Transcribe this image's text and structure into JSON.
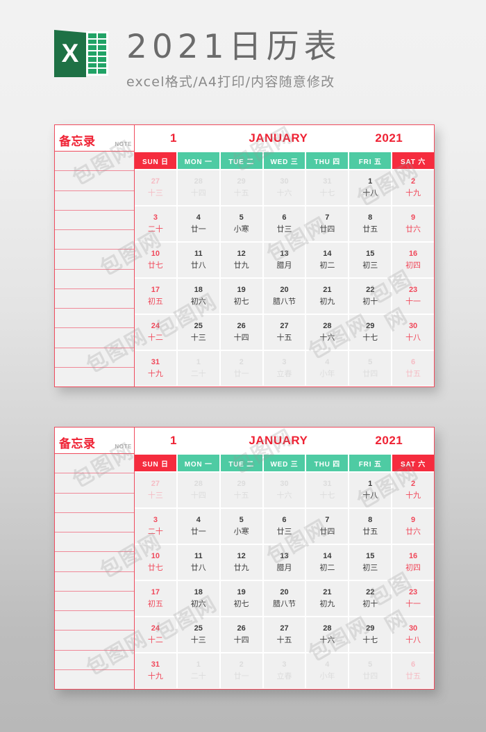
{
  "header": {
    "logo_icon": "excel-logo-icon",
    "logo_letter": "X",
    "title": "2021日历表",
    "subtitle": "excel格式/A4打印/内容随意修改"
  },
  "memo": {
    "title": "备忘录",
    "note_label": "NOTE",
    "line_count": 12
  },
  "calendar": {
    "month_number": "1",
    "month_name": "JANUARY",
    "year": "2021",
    "weekdays": [
      {
        "label": "SUN 日",
        "weekend": true
      },
      {
        "label": "MON 一",
        "weekend": false
      },
      {
        "label": "TUE 二",
        "weekend": false
      },
      {
        "label": "WED 三",
        "weekend": false
      },
      {
        "label": "THU 四",
        "weekend": false
      },
      {
        "label": "FRI 五",
        "weekend": false
      },
      {
        "label": "SAT 六",
        "weekend": true
      }
    ],
    "weeks": [
      [
        {
          "num": "27",
          "lunar": "十三",
          "other": true
        },
        {
          "num": "28",
          "lunar": "十四",
          "other": true
        },
        {
          "num": "29",
          "lunar": "十五",
          "other": true
        },
        {
          "num": "30",
          "lunar": "十六",
          "other": true
        },
        {
          "num": "31",
          "lunar": "十七",
          "other": true
        },
        {
          "num": "1",
          "lunar": "十八",
          "other": false
        },
        {
          "num": "2",
          "lunar": "十九",
          "other": false
        }
      ],
      [
        {
          "num": "3",
          "lunar": "二十",
          "other": false
        },
        {
          "num": "4",
          "lunar": "廿一",
          "other": false
        },
        {
          "num": "5",
          "lunar": "小寒",
          "other": false
        },
        {
          "num": "6",
          "lunar": "廿三",
          "other": false
        },
        {
          "num": "7",
          "lunar": "廿四",
          "other": false
        },
        {
          "num": "8",
          "lunar": "廿五",
          "other": false
        },
        {
          "num": "9",
          "lunar": "廿六",
          "other": false
        }
      ],
      [
        {
          "num": "10",
          "lunar": "廿七",
          "other": false
        },
        {
          "num": "11",
          "lunar": "廿八",
          "other": false
        },
        {
          "num": "12",
          "lunar": "廿九",
          "other": false
        },
        {
          "num": "13",
          "lunar": "腊月",
          "other": false
        },
        {
          "num": "14",
          "lunar": "初二",
          "other": false
        },
        {
          "num": "15",
          "lunar": "初三",
          "other": false
        },
        {
          "num": "16",
          "lunar": "初四",
          "other": false
        }
      ],
      [
        {
          "num": "17",
          "lunar": "初五",
          "other": false
        },
        {
          "num": "18",
          "lunar": "初六",
          "other": false
        },
        {
          "num": "19",
          "lunar": "初七",
          "other": false
        },
        {
          "num": "20",
          "lunar": "腊八节",
          "other": false
        },
        {
          "num": "21",
          "lunar": "初九",
          "other": false
        },
        {
          "num": "22",
          "lunar": "初十",
          "other": false
        },
        {
          "num": "23",
          "lunar": "十一",
          "other": false
        }
      ],
      [
        {
          "num": "24",
          "lunar": "十二",
          "other": false
        },
        {
          "num": "25",
          "lunar": "十三",
          "other": false
        },
        {
          "num": "26",
          "lunar": "十四",
          "other": false
        },
        {
          "num": "27",
          "lunar": "十五",
          "other": false
        },
        {
          "num": "28",
          "lunar": "十六",
          "other": false
        },
        {
          "num": "29",
          "lunar": "十七",
          "other": false
        },
        {
          "num": "30",
          "lunar": "十八",
          "other": false
        }
      ],
      [
        {
          "num": "31",
          "lunar": "十九",
          "other": false
        },
        {
          "num": "1",
          "lunar": "二十",
          "other": true
        },
        {
          "num": "2",
          "lunar": "廿一",
          "other": true
        },
        {
          "num": "3",
          "lunar": "立春",
          "other": true
        },
        {
          "num": "4",
          "lunar": "小年",
          "other": true
        },
        {
          "num": "5",
          "lunar": "廿四",
          "other": true
        },
        {
          "num": "6",
          "lunar": "廿五",
          "other": true
        }
      ]
    ]
  },
  "colors": {
    "accent_red": "#f52c3e",
    "accent_green": "#4ecba3",
    "border_red": "#ef4a5c",
    "cell_bg": "#f0f0f0",
    "title_gray": "#6b6b6b"
  },
  "watermark": {
    "text": "包图网"
  }
}
